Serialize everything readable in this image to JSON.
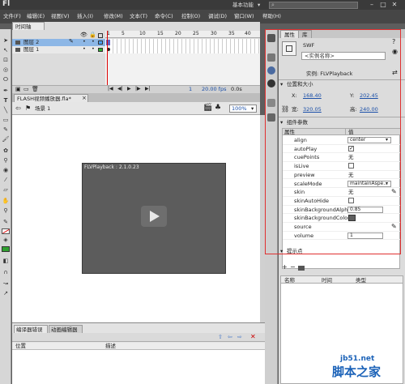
{
  "app": {
    "logo": "Fl",
    "workspace": "基本功能",
    "window_controls": [
      "–",
      "□",
      "✕"
    ]
  },
  "menu": [
    "文件(F)",
    "编辑(E)",
    "视图(V)",
    "插入(I)",
    "修改(M)",
    "文本(T)",
    "命令(C)",
    "控制(O)",
    "调试(D)",
    "窗口(W)",
    "帮助(H)"
  ],
  "timeline": {
    "tab": "时间轴",
    "layers": [
      {
        "name": "图层 2",
        "selected": true
      },
      {
        "name": "图层 1",
        "selected": false
      }
    ],
    "ruler": [
      "1",
      "5",
      "10",
      "15",
      "20",
      "25",
      "30",
      "35",
      "40",
      "45"
    ],
    "status": {
      "frame": "1",
      "fps": "20.00 fps",
      "time": "0.0s"
    }
  },
  "document": {
    "tab": "FLASH视频播放器.fla*",
    "scene": "场景 1",
    "zoom": "100%"
  },
  "stage": {
    "player_label": "FLVPlayback : 2.1.0.23"
  },
  "bottom_panel": {
    "tabs": [
      "编译器错误",
      "动画编辑器"
    ],
    "columns": [
      "位置",
      "描述"
    ]
  },
  "properties": {
    "tabs": [
      "属性",
      "库"
    ],
    "swf_label": "SWF",
    "instance_placeholder": "<实例名称>",
    "instance_of": "实例: FLVPlayback",
    "position_section": "位置和大小",
    "x_label": "X:",
    "x_value": "168.40",
    "y_label": "Y:",
    "y_value": "202.45",
    "w_label": "宽:",
    "w_value": "320.05",
    "h_label": "高:",
    "h_value": "240.00",
    "component_section": "组件参数",
    "grid_headers": [
      "属性",
      "值"
    ],
    "params": [
      {
        "name": "align",
        "value": "center",
        "kind": "select"
      },
      {
        "name": "autoPlay",
        "value": "",
        "kind": "check",
        "checked": true
      },
      {
        "name": "cuePoints",
        "value": "无",
        "kind": "text"
      },
      {
        "name": "isLive",
        "value": "",
        "kind": "check",
        "checked": false
      },
      {
        "name": "preview",
        "value": "无",
        "kind": "text"
      },
      {
        "name": "scaleMode",
        "value": "maintainAspe...",
        "kind": "select"
      },
      {
        "name": "skin",
        "value": "无",
        "kind": "text"
      },
      {
        "name": "skinAutoHide",
        "value": "",
        "kind": "check",
        "checked": false
      },
      {
        "name": "skinBackgroundAlpha",
        "value": "0.85",
        "kind": "input"
      },
      {
        "name": "skinBackgroundColor",
        "value": "",
        "kind": "color"
      },
      {
        "name": "source",
        "value": "",
        "kind": "text"
      },
      {
        "name": "volume",
        "value": "1",
        "kind": "input"
      }
    ],
    "hint_section": "提示点",
    "hint_columns": [
      "名称",
      "时间",
      "类型"
    ]
  },
  "watermark": {
    "url": "jb51.net",
    "site": "脚本之家"
  }
}
